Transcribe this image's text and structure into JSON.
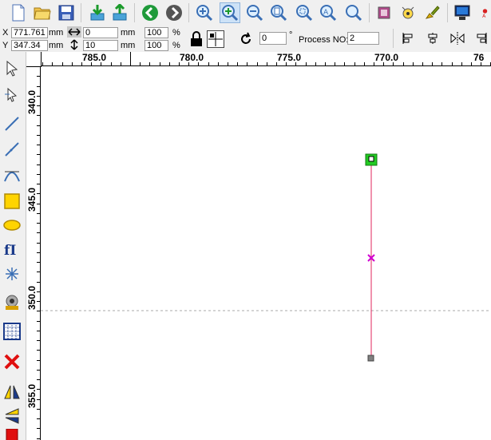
{
  "toolbar": {
    "buttons": [
      {
        "name": "new-file-icon"
      },
      {
        "name": "open-folder-icon"
      },
      {
        "name": "save-icon"
      },
      {
        "name": "import-icon"
      },
      {
        "name": "export-icon"
      },
      {
        "name": "back-icon"
      },
      {
        "name": "forward-icon"
      },
      {
        "name": "zoom-in-icon"
      },
      {
        "name": "zoom-select-icon"
      },
      {
        "name": "zoom-out-icon"
      },
      {
        "name": "zoom-page-icon"
      },
      {
        "name": "zoom-all-icon"
      },
      {
        "name": "zoom-fit-icon"
      },
      {
        "name": "zoom-actual-icon"
      },
      {
        "name": "frame-icon"
      },
      {
        "name": "target-icon"
      },
      {
        "name": "brush-icon"
      },
      {
        "name": "monitor-icon"
      }
    ]
  },
  "props": {
    "x_label": "X",
    "y_label": "Y",
    "x_value": "771.761",
    "y_value": "347.34",
    "x_unit": "mm",
    "y_unit": "mm",
    "width_value": "0",
    "height_value": "10",
    "width_unit": "mm",
    "height_unit": "mm",
    "scale_x": "100",
    "scale_y": "100",
    "pct_x": "%",
    "pct_y": "%",
    "rotate_value": "0",
    "rotate_unit": "°",
    "process_label": "Process NO:",
    "process_value": "2"
  },
  "ruler": {
    "h_labels": [
      "785.0",
      "780.0",
      "775.0",
      "770.0",
      "76"
    ],
    "v_labels": [
      "340.0",
      "345.0",
      "350.0",
      "355.0"
    ]
  },
  "lefttools": [
    "select-arrow-icon",
    "node-edit-icon",
    "line-icon",
    "polyline-icon",
    "bezier-icon",
    "rectangle-icon",
    "ellipse-icon",
    "text-icon",
    "star-icon",
    "camera-icon",
    "grid-array-icon",
    "delete-icon",
    "mirror-horizontal-icon",
    "mirror-vertical-icon",
    "fill-icon"
  ],
  "colors": {
    "line": "#e0245e",
    "start_marker": "#22cc22",
    "center_marker": "#d000d0",
    "end_marker": "#808080"
  }
}
